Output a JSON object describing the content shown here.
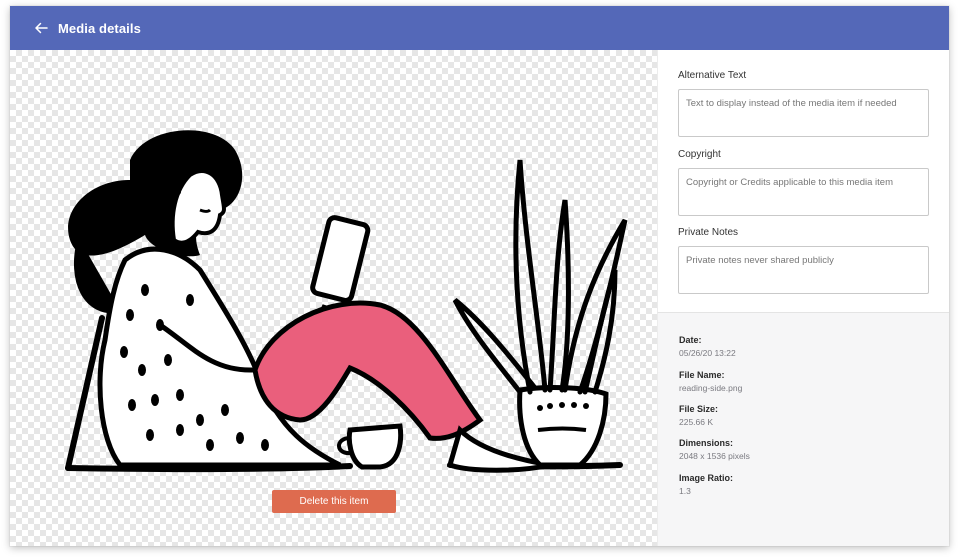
{
  "header": {
    "title": "Media details"
  },
  "preview": {
    "delete_label": "Delete this item",
    "colors": {
      "pants": "#ea5f7c",
      "ink": "#000000",
      "header": "#5468b8",
      "delete_button": "#de6b4f"
    }
  },
  "form": {
    "alt_text": {
      "label": "Alternative Text",
      "placeholder": "Text to display instead of the media item if needed",
      "value": ""
    },
    "copyright": {
      "label": "Copyright",
      "placeholder": "Copyright or Credits applicable to this media item",
      "value": ""
    },
    "private_notes": {
      "label": "Private Notes",
      "placeholder": "Private notes never shared publicly",
      "value": ""
    }
  },
  "meta": {
    "date": {
      "label": "Date:",
      "value": "05/26/20 13:22"
    },
    "file_name": {
      "label": "File Name:",
      "value": "reading-side.png"
    },
    "file_size": {
      "label": "File Size:",
      "value": "225.66 K"
    },
    "dimensions": {
      "label": "Dimensions:",
      "value": "2048 x 1536 pixels"
    },
    "aspect_ratio": {
      "label": "Image Ratio:",
      "value": "1.3"
    }
  }
}
